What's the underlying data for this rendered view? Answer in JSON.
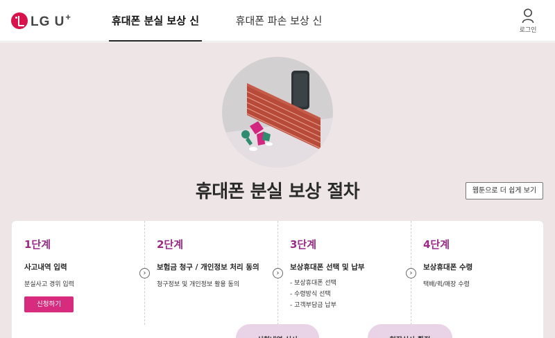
{
  "header": {
    "logo_text": "LG U",
    "logo_plus": "+",
    "tabs": [
      {
        "label": "휴대폰 분실 보상 신청"
      },
      {
        "label": "휴대폰 파손 보상 신청"
      }
    ],
    "login_label": "로그인"
  },
  "hero": {
    "title": "휴대폰 분실 보상 절차",
    "easy_button": "웹툰으로 더 쉽게 보기"
  },
  "steps": [
    {
      "num": "1단계",
      "name": "사고내역 입력",
      "desc": "분실사고 경위 입력",
      "button": "신청하기"
    },
    {
      "num": "2단계",
      "name": "보험금 청구 / 개인정보 처리 동의",
      "desc": "청구정보 및 개인정보 활용 동의"
    },
    {
      "num": "3단계",
      "name": "보상휴대폰 선택 및 납부",
      "items": [
        "- 보상휴대폰 선택",
        "- 수령방식 선택",
        "- 고객부담금 납부"
      ]
    },
    {
      "num": "4단계",
      "name": "보상휴대폰 수령",
      "desc": "택배/퀵/매장 수령"
    }
  ],
  "arrow_glyph": "›",
  "bottom_pills": [
    "신청내역 심사",
    "현장심사 확정"
  ],
  "colors": {
    "brand": "#d8124a",
    "accent": "#9b2a86",
    "button": "#d72c7e",
    "hero_bg": "#ede5e6"
  }
}
